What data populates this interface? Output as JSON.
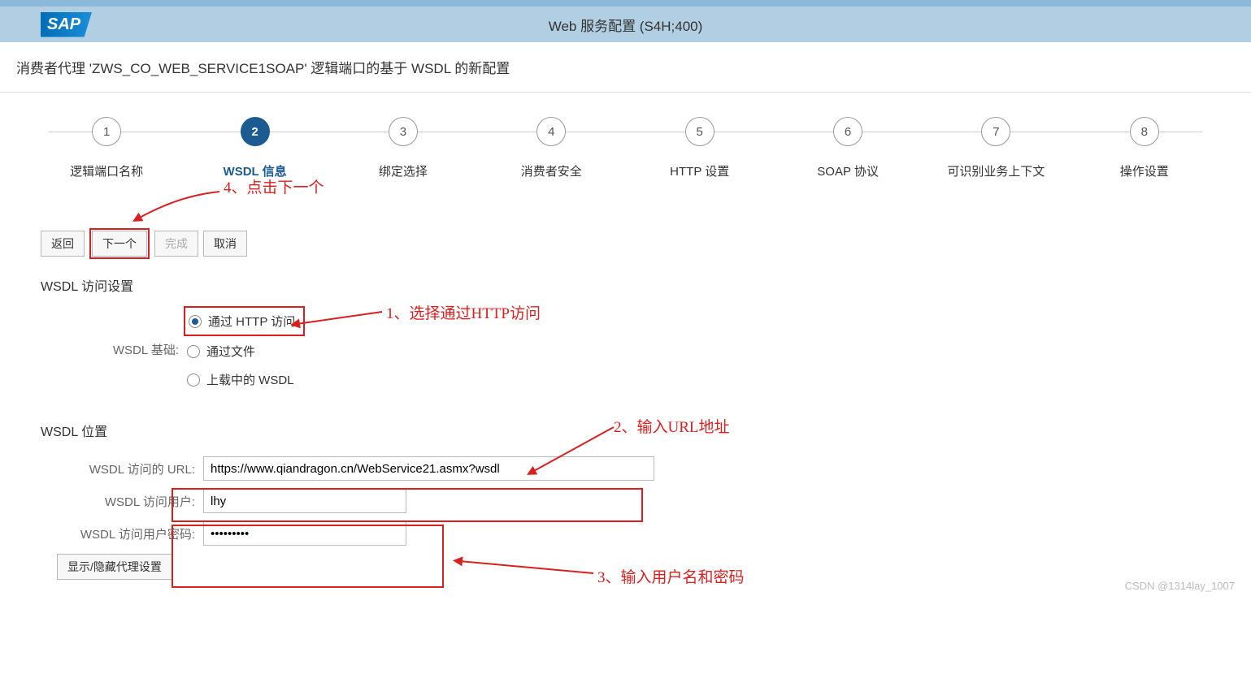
{
  "header": {
    "title": "Web 服务配置 (S4H;400)",
    "logo": "SAP"
  },
  "subtitle": "消费者代理 'ZWS_CO_WEB_SERVICE1SOAP' 逻辑端口的基于 WSDL 的新配置",
  "wizard": {
    "steps": [
      {
        "num": "1",
        "label": "逻辑端口名称"
      },
      {
        "num": "2",
        "label": "WSDL 信息",
        "active": true
      },
      {
        "num": "3",
        "label": "绑定选择"
      },
      {
        "num": "4",
        "label": "消费者安全"
      },
      {
        "num": "5",
        "label": "HTTP 设置"
      },
      {
        "num": "6",
        "label": "SOAP 协议"
      },
      {
        "num": "7",
        "label": "可识别业务上下文"
      },
      {
        "num": "8",
        "label": "操作设置"
      }
    ]
  },
  "buttons": {
    "back": "返回",
    "next": "下一个",
    "finish": "完成",
    "cancel": "取消"
  },
  "section1": {
    "title": "WSDL 访问设置",
    "base_label": "WSDL 基础:",
    "radios": {
      "http": "通过 HTTP 访问",
      "file": "通过文件",
      "upload": "上载中的 WSDL"
    }
  },
  "section2": {
    "title": "WSDL 位置",
    "url_label": "WSDL 访问的 URL:",
    "url_value": "https://www.qiandragon.cn/WebService21.asmx?wsdl",
    "user_label": "WSDL 访问用户:",
    "user_value": "lhy",
    "pwd_label": "WSDL 访问用户密码:",
    "pwd_value": "•••••••••",
    "proxy_btn": "显示/隐藏代理设置"
  },
  "annotations": {
    "a1": "1、选择通过HTTP访问",
    "a2": "2、输入URL地址",
    "a3": "3、输入用户名和密码",
    "a4": "4、点击下一个"
  },
  "watermark": "CSDN @1314lay_1007"
}
